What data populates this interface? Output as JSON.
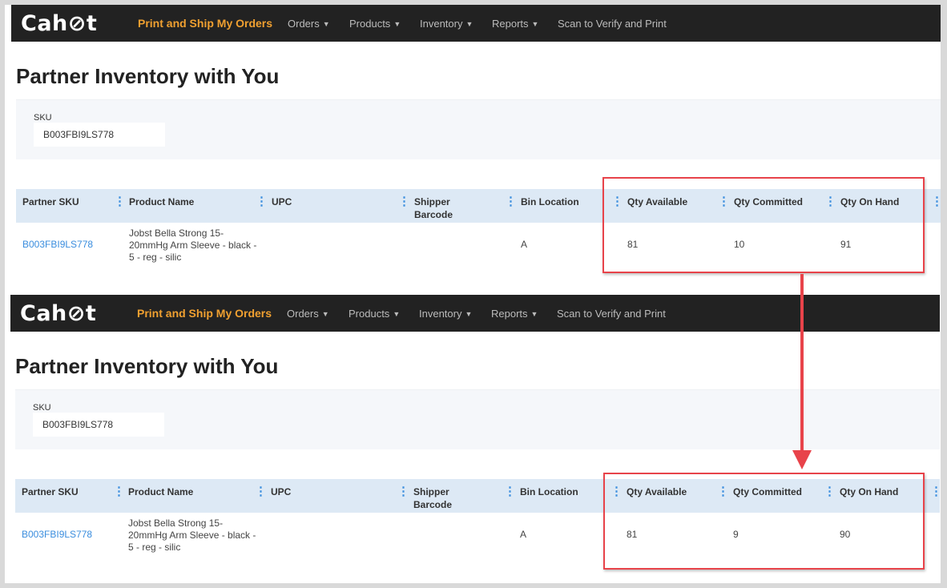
{
  "panels": [
    {
      "nav": {
        "logo": "Cahoot",
        "brand_link": "Print and Ship My Orders",
        "items": [
          "Orders",
          "Products",
          "Inventory",
          "Reports",
          "Scan to Verify and Print"
        ]
      },
      "title": "Partner Inventory with You",
      "filter": {
        "label": "SKU",
        "value": "B003FBI9LS778"
      },
      "columns": [
        "Partner SKU",
        "Product Name",
        "UPC",
        "Shipper Barcode",
        "Bin Location",
        "Qty Available",
        "Qty Committed",
        "Qty On Hand"
      ],
      "row": {
        "partner_sku": "B003FBI9LS778",
        "product_name": "Jobst Bella Strong 15-20mmHg Arm Sleeve - black - 5 - reg - silic",
        "upc": "",
        "shipper_barcode": "",
        "bin_location": "A",
        "qty_available": "81",
        "qty_committed": "10",
        "qty_on_hand": "91"
      }
    },
    {
      "nav": {
        "logo": "Cahoot",
        "brand_link": "Print and Ship My Orders",
        "items": [
          "Orders",
          "Products",
          "Inventory",
          "Reports",
          "Scan to Verify and Print"
        ]
      },
      "title": "Partner Inventory with You",
      "filter": {
        "label": "SKU",
        "value": "B003FBI9LS778"
      },
      "columns": [
        "Partner SKU",
        "Product Name",
        "UPC",
        "Shipper Barcode",
        "Bin Location",
        "Qty Available",
        "Qty Committed",
        "Qty On Hand"
      ],
      "row": {
        "partner_sku": "B003FBI9LS778",
        "product_name": "Jobst Bella Strong 15-20mmHg Arm Sleeve - black - 5 - reg - silic",
        "upc": "",
        "shipper_barcode": "",
        "bin_location": "A",
        "qty_available": "81",
        "qty_committed": "9",
        "qty_on_hand": "90"
      }
    }
  ],
  "annotation": {
    "highlight_color": "#e8434a",
    "arrow_icon": "down-arrow-icon"
  },
  "colors": {
    "nav_bg": "#222222",
    "brand_link": "#f0a030",
    "link": "#3a8dde",
    "header_bg": "#dde9f5"
  }
}
